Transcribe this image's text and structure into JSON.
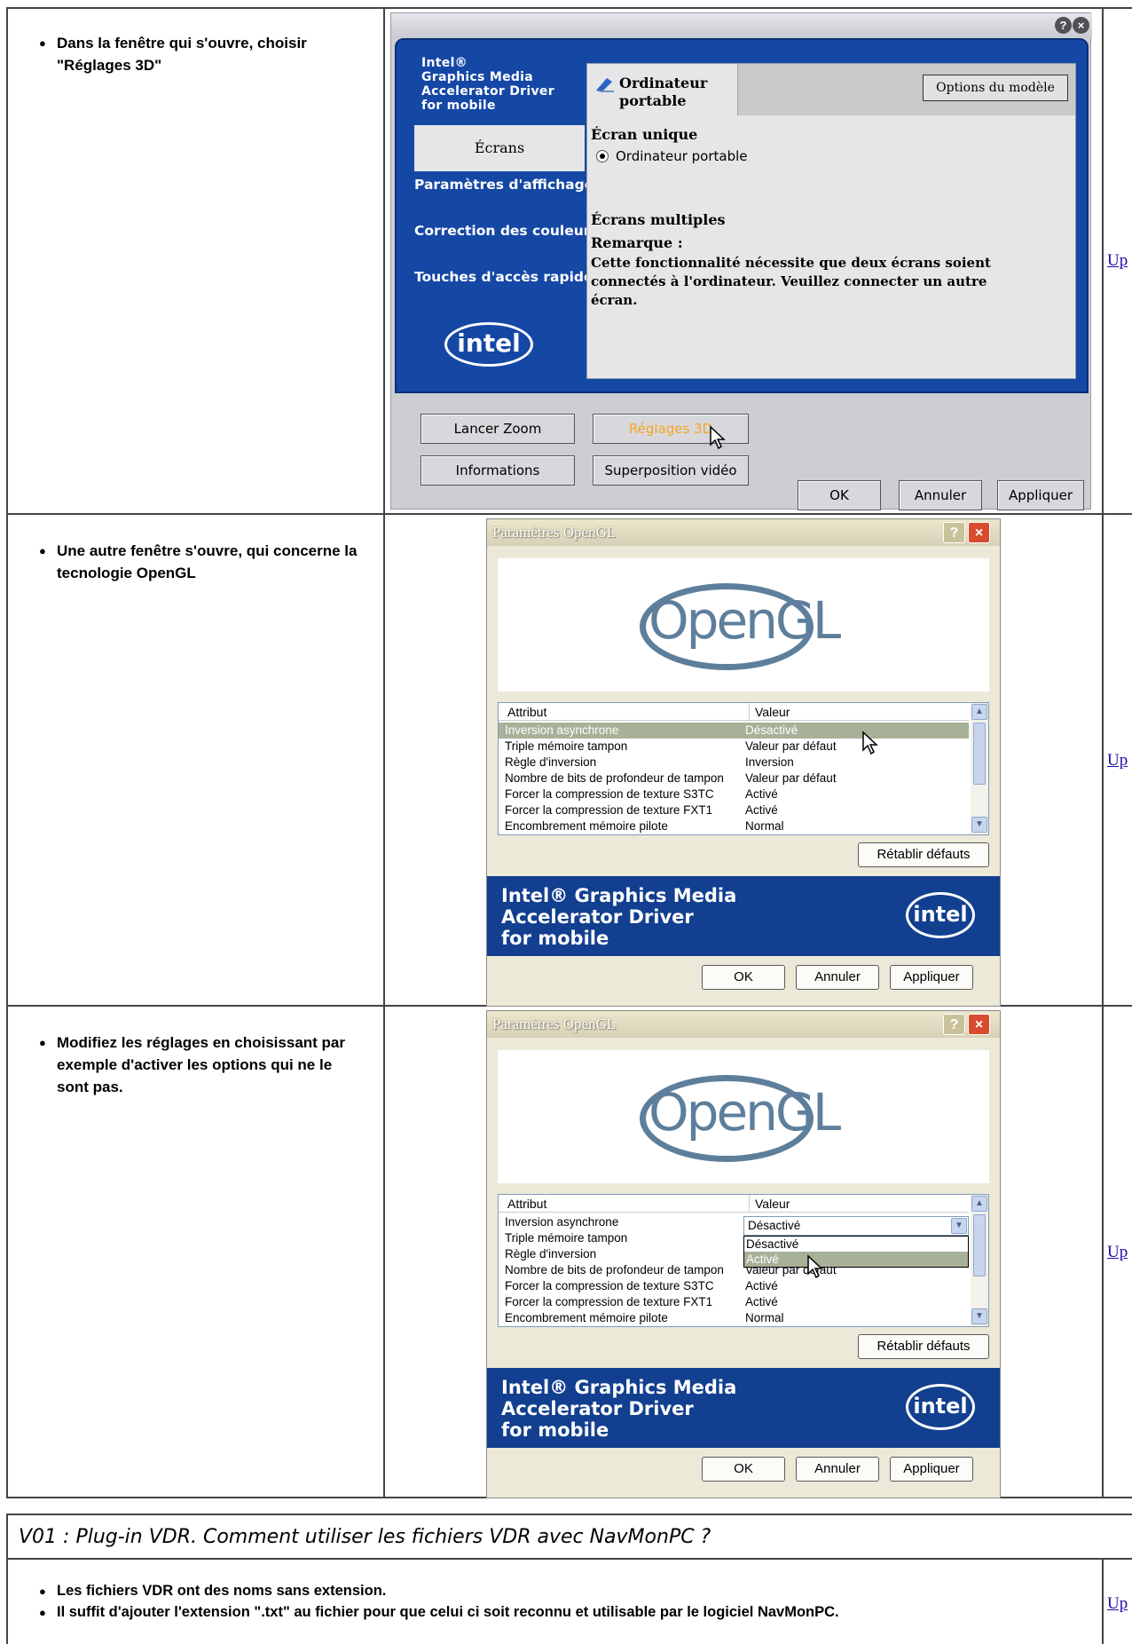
{
  "rows": [
    {
      "note": "Dans la fenêtre qui s'ouvre, choisir \"Réglages 3D\"",
      "link": "Up"
    },
    {
      "note": "Une autre fenêtre s'ouvre, qui concerne la tecnologie OpenGL",
      "link": "Up"
    },
    {
      "note": "Modifiez les réglages en choisissant par exemple d'activer les options qui ne le sont pas.",
      "link": "Up"
    }
  ],
  "intel_window": {
    "brand": [
      "Intel®",
      "Graphics Media",
      "Accelerator Driver",
      "for mobile"
    ],
    "nav_selected": "Écrans",
    "nav_items": [
      "Paramètres d'affichage",
      "Correction des couleurs",
      "Touches d'accès rapide"
    ],
    "logo": "intel",
    "device_line1": "Ordinateur",
    "device_line2": "portable",
    "model_options_button": "Options du modèle",
    "single_screen_label": "Écran unique",
    "radio_label": "Ordinateur portable",
    "multi_screen_label": "Écrans multiples",
    "note_title": "Remarque :",
    "note_text": "Cette fonctionnalité nécessite que deux écrans soient connectés à l'ordinateur. Veuillez connecter un autre écran.",
    "buttons": {
      "zoom": "Lancer Zoom",
      "settings3d": "Réglages 3D",
      "info": "Informations",
      "video": "Superposition vidéo",
      "ok": "OK",
      "cancel": "Annuler",
      "apply": "Appliquer"
    },
    "help_glyph": "?",
    "close_glyph": "×"
  },
  "opengl_windows": [
    {
      "title": "Paramètres OpenGL",
      "logo_text": "OpenGL",
      "col_attr": "Attribut",
      "col_val": "Valeur",
      "rows": [
        {
          "a": "Inversion asynchrone",
          "v": "Désactivé",
          "selected": true
        },
        {
          "a": "Triple mémoire tampon",
          "v": "Valeur par défaut"
        },
        {
          "a": "Règle d'inversion",
          "v": "Inversion"
        },
        {
          "a": "Nombre de bits de profondeur de tampon",
          "v": "Valeur par défaut"
        },
        {
          "a": "Forcer la compression de texture S3TC",
          "v": "Activé"
        },
        {
          "a": "Forcer la compression de texture FXT1",
          "v": "Activé"
        },
        {
          "a": "Encombrement mémoire pilote",
          "v": "Normal"
        }
      ],
      "reset": "Rétablir défauts",
      "banner": [
        "Intel® Graphics Media",
        "Accelerator Driver",
        "for mobile"
      ],
      "ok": "OK",
      "cancel": "Annuler",
      "apply": "Appliquer"
    },
    {
      "title": "Paramètres OpenGL",
      "logo_text": "OpenGL",
      "col_attr": "Attribut",
      "col_val": "Valeur",
      "rows": [
        {
          "a": "Inversion asynchrone",
          "v": ""
        },
        {
          "a": "Triple mémoire tampon",
          "v": ""
        },
        {
          "a": "Règle d'inversion",
          "v": ""
        },
        {
          "a": "Nombre de bits de profondeur de tampon",
          "v": "Valeur par défaut"
        },
        {
          "a": "Forcer la compression de texture S3TC",
          "v": "Activé"
        },
        {
          "a": "Forcer la compression de texture FXT1",
          "v": "Activé"
        },
        {
          "a": "Encombrement mémoire pilote",
          "v": "Normal"
        }
      ],
      "combo_value": "Désactivé",
      "dropdown_options": [
        "Désactivé",
        "Activé"
      ],
      "reset": "Rétablir défauts",
      "banner": [
        "Intel® Graphics Media",
        "Accelerator Driver",
        "for mobile"
      ],
      "ok": "OK",
      "cancel": "Annuler",
      "apply": "Appliquer"
    }
  ],
  "section": {
    "title": "V01 : Plug-in VDR. Comment utiliser les fichiers VDR avec NavMonPC ?",
    "bullets": [
      "Les fichiers VDR ont des noms sans extension.",
      "Il suffit d'ajouter l'extension \".txt\" au fichier pour que celui ci soit reconnu et utilisable par le logiciel NavMonPC."
    ],
    "link": "Up"
  },
  "colors": {
    "intel_blue": "#1547a5",
    "selected_row": "#a7b198",
    "settings3d_text": "#f5a623",
    "link": "#1a0dab"
  }
}
